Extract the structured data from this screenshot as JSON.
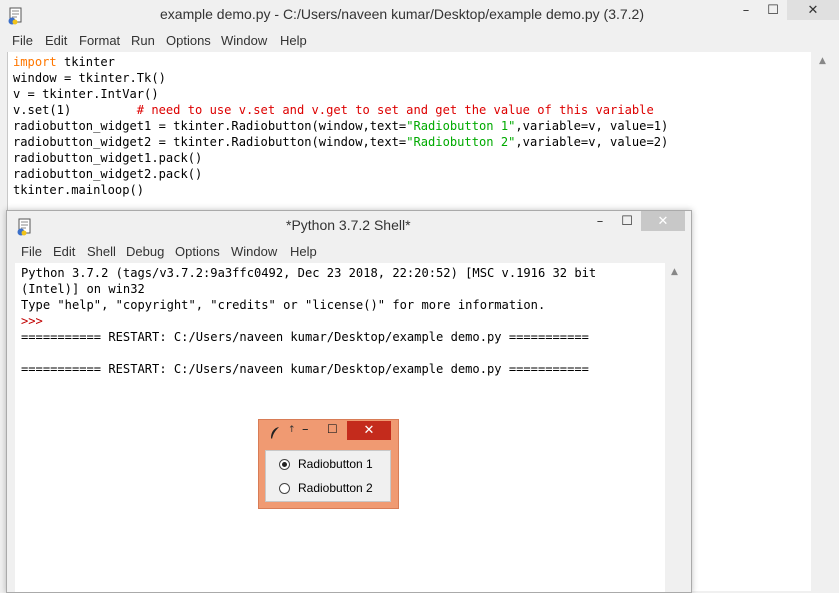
{
  "editor": {
    "title": "example demo.py - C:/Users/naveen kumar/Desktop/example demo.py (3.7.2)",
    "menu": [
      "File",
      "Edit",
      "Format",
      "Run",
      "Options",
      "Window",
      "Help"
    ],
    "code": {
      "line1_kw": "import",
      "line1_rest": " tkinter",
      "line2": "window = tkinter.Tk()",
      "line3": "v = tkinter.IntVar()",
      "line4_code": "v.set(1)         ",
      "line4_comment": "# need to use v.set and v.get to set and get the value of this variable",
      "line5_a": "radiobutton_widget1 = tkinter.Radiobutton(window,text=",
      "line5_str": "\"Radiobutton 1\"",
      "line5_b": ",variable=v, value=1)",
      "line6_a": "radiobutton_widget2 = tkinter.Radiobutton(window,text=",
      "line6_str": "\"Radiobutton 2\"",
      "line6_b": ",variable=v, value=2)",
      "line7": "radiobutton_widget1.pack()",
      "line8": "radiobutton_widget2.pack()",
      "line9": "tkinter.mainloop()"
    }
  },
  "shell": {
    "title": "*Python 3.7.2 Shell*",
    "menu": [
      "File",
      "Edit",
      "Shell",
      "Debug",
      "Options",
      "Window",
      "Help"
    ],
    "output": {
      "line1": "Python 3.7.2 (tags/v3.7.2:9a3ffc0492, Dec 23 2018, 22:20:52) [MSC v.1916 32 bit",
      "line2": "(Intel)] on win32",
      "line3": "Type \"help\", \"copyright\", \"credits\" or \"license()\" for more information.",
      "prompt": ">>>",
      "restart1": "=========== RESTART: C:/Users/naveen kumar/Desktop/example demo.py ===========",
      "restart2": "=========== RESTART: C:/Users/naveen kumar/Desktop/example demo.py ==========="
    }
  },
  "tk_window": {
    "radio1_label": "Radiobutton 1",
    "radio2_label": "Radiobutton 2",
    "selected_value": 1,
    "close_glyph": "✕",
    "title_glyph": "↑"
  },
  "icons": {
    "minimize": "–",
    "maximize": "☐",
    "close": "✕",
    "scroll_up": "▲"
  },
  "colors": {
    "keyword": "#ff7700",
    "string": "#00aa00",
    "comment": "#dd0000",
    "prompt": "#c00000",
    "tk_frame": "#f09a72",
    "tk_close": "#c42b1c"
  }
}
